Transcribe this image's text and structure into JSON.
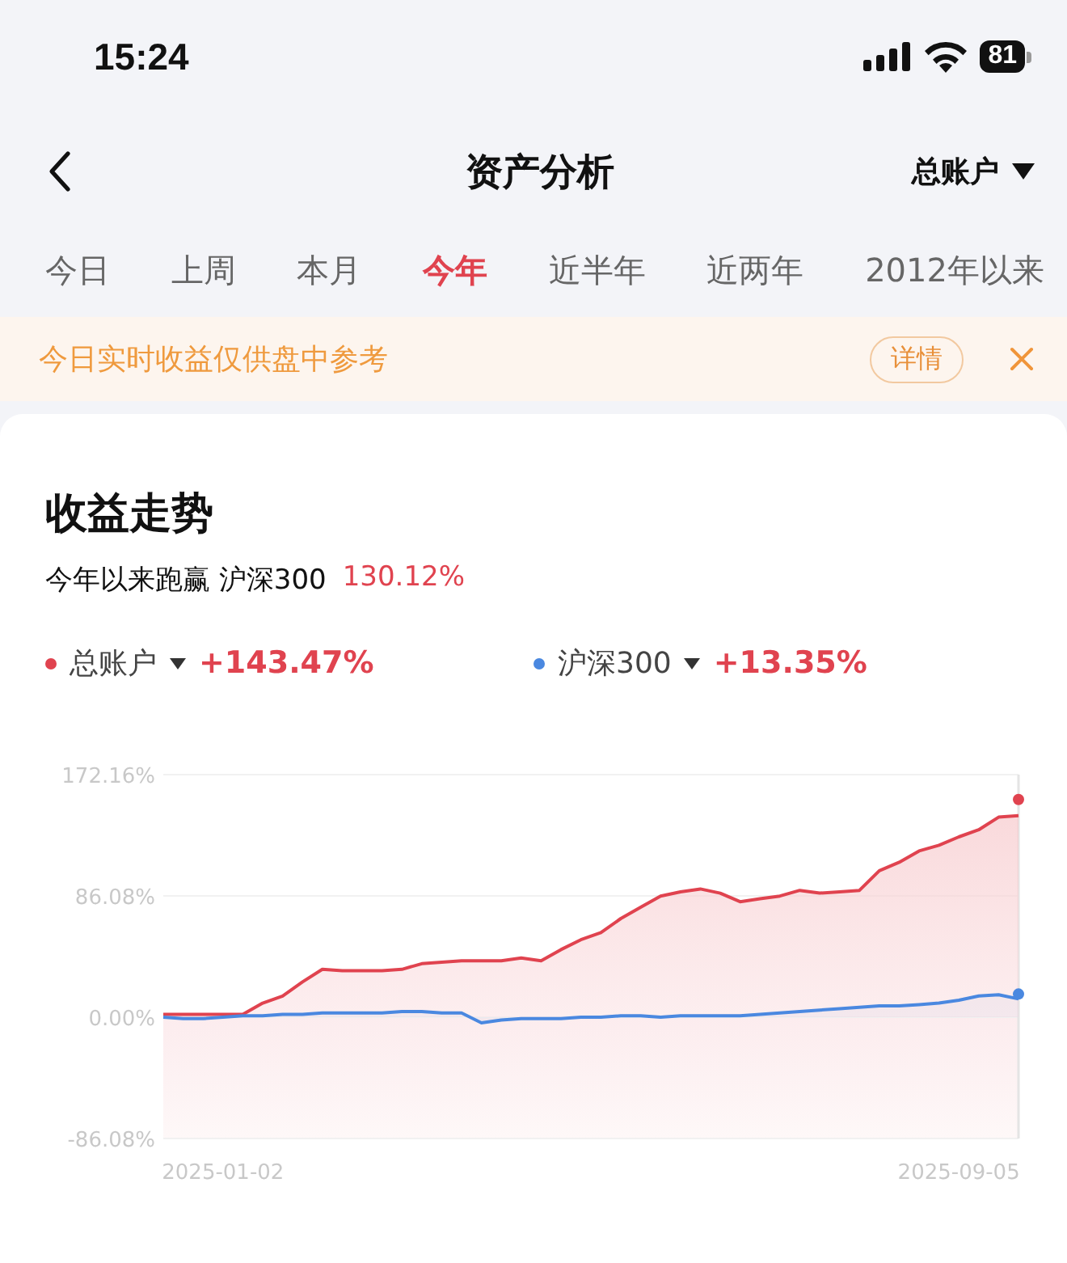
{
  "status_bar": {
    "time": "15:24",
    "battery": "81"
  },
  "nav": {
    "title": "资产分析",
    "account": "总账户"
  },
  "tabs": [
    {
      "label": "今日",
      "selected": false
    },
    {
      "label": "上周",
      "selected": false
    },
    {
      "label": "本月",
      "selected": false
    },
    {
      "label": "今年",
      "selected": true
    },
    {
      "label": "近半年",
      "selected": false
    },
    {
      "label": "近两年",
      "selected": false
    },
    {
      "label": "2012年以来",
      "selected": false
    }
  ],
  "notice": {
    "text": "今日实时收益仅供盘中参考",
    "button": "详情"
  },
  "card": {
    "title": "收益走势",
    "summary_label": "今年以来跑赢 沪深300",
    "summary_value": "130.12%",
    "legend": [
      {
        "value": "+143.47%"
      },
      {
        "value": "+13.35%"
      }
    ],
    "chart_data": {
      "type": "area",
      "categories": [
        null,
        null,
        null,
        "2025-01-02",
        null,
        null,
        null,
        null,
        null,
        null,
        null,
        null,
        null,
        null,
        null,
        null,
        null,
        null,
        null,
        null,
        null,
        null,
        null,
        null,
        null,
        null,
        null,
        null,
        null,
        null,
        null,
        null,
        null,
        null,
        null,
        null,
        null,
        null,
        null,
        null,
        "2025-09-05",
        null,
        null,
        null
      ],
      "ylim": [
        -86.08,
        172.16
      ],
      "yticks": [
        {
          "value": 172.16,
          "label": "172.16%"
        },
        {
          "value": 86.08,
          "label": "86.08%"
        },
        {
          "value": 0,
          "label": "0.00%"
        },
        {
          "value": -86.08,
          "label": "-86.08%"
        }
      ],
      "series": [
        {
          "name": "总账户",
          "color": "#e0434f",
          "values": [
            2,
            2,
            2,
            2,
            2,
            10,
            15,
            25,
            34,
            33,
            33,
            33,
            34,
            38,
            39,
            40,
            40,
            40,
            42,
            40,
            48,
            55,
            60,
            70,
            78,
            86,
            89,
            91,
            88,
            82,
            84,
            86,
            90,
            88,
            89,
            90,
            104,
            110,
            118,
            122,
            128,
            133,
            142,
            143
          ]
        },
        {
          "name": "沪深300",
          "color": "#4a88e0",
          "values": [
            0,
            -1,
            -1,
            0,
            1,
            1,
            2,
            2,
            3,
            3,
            3,
            3,
            4,
            4,
            3,
            3,
            -4,
            -2,
            -1,
            -1,
            -1,
            0,
            0,
            1,
            1,
            0,
            1,
            1,
            1,
            1,
            2,
            3,
            4,
            5,
            6,
            7,
            8,
            8,
            9,
            10,
            12,
            15,
            16,
            13
          ]
        }
      ]
    }
  }
}
